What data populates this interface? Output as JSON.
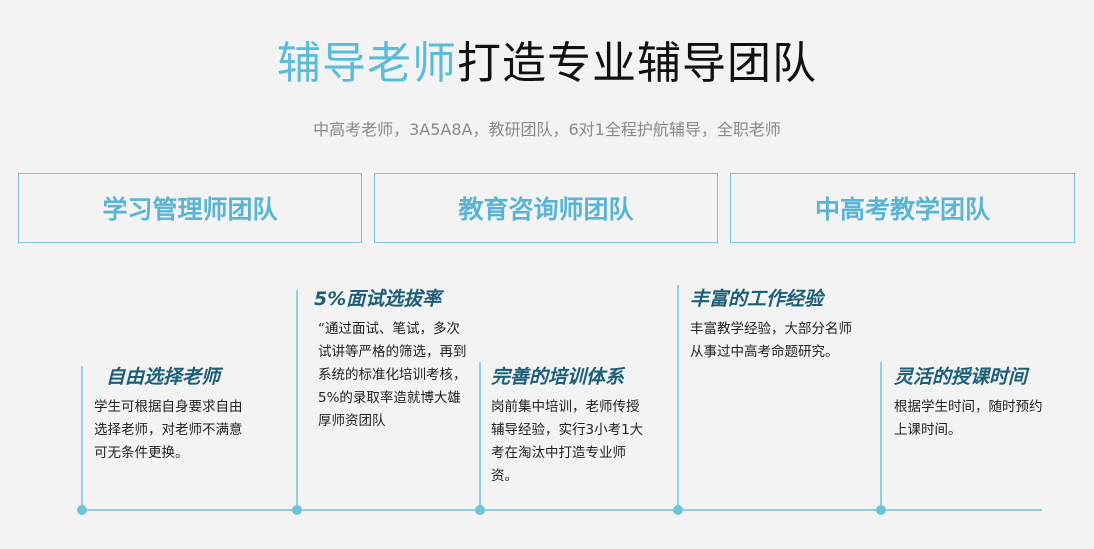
{
  "header": {
    "title_highlight": "辅导老师",
    "title_rest": "打造专业辅导团队",
    "subtitle": "中高考老师，3A5A8A，教研团队，6对1全程护航辅导，全职老师"
  },
  "teams": [
    {
      "label": "学习管理师团队"
    },
    {
      "label": "教育咨询师团队"
    },
    {
      "label": "中高考教学团队"
    }
  ],
  "timeline": [
    {
      "title": "自由选择老师",
      "text": "学生可根据自身要求自由选择老师，对老师不满意可无条件更换。"
    },
    {
      "title": "5%面试选拔率",
      "text": "“通过面试、笔试，多次试讲等严格的筛选，再到系统的标准化培训考核，5%的录取率造就博大雄厚师资团队"
    },
    {
      "title": "完善的培训体系",
      "text": "岗前集中培训，老师传授辅导经验，实行3小考1大考在淘汰中打造专业师资。"
    },
    {
      "title": "丰富的工作经验",
      "text": "丰富教学经验，大部分名师从事过中高考命题研究。"
    },
    {
      "title": "灵活的授课时间",
      "text": "根据学生时间，随时预约上课时间。"
    }
  ],
  "colors": {
    "accent": "#5bbcd9",
    "card_title": "#1e5f78",
    "line": "#8fd0e3",
    "background": "#f3f3f3"
  }
}
